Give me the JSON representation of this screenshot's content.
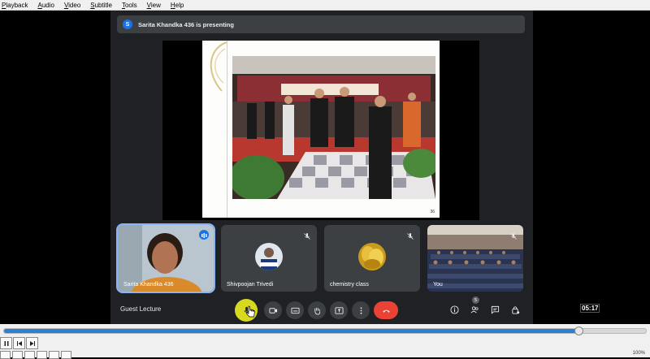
{
  "menu": [
    "Playback",
    "Audio",
    "Video",
    "Subtitle",
    "Tools",
    "View",
    "Help"
  ],
  "meet": {
    "presenting_avatar": "S",
    "presenting_text": "Sarita Khandka 436 is presenting",
    "slide_page": "36",
    "participants": [
      {
        "name": "Sarita Khandka 436",
        "speaking": true
      },
      {
        "name": "Shivpoojan Trivedi",
        "muted": true
      },
      {
        "name": "chemistry class",
        "muted": true
      },
      {
        "name": "You",
        "muted": true
      }
    ],
    "meeting_title": "Guest Lecture",
    "people_count": "5",
    "accent": "#1a73e8",
    "hangup_color": "#ea4335"
  },
  "vlc": {
    "timecode": "05:17",
    "seek_fraction": 0.895,
    "volume": "100%"
  }
}
